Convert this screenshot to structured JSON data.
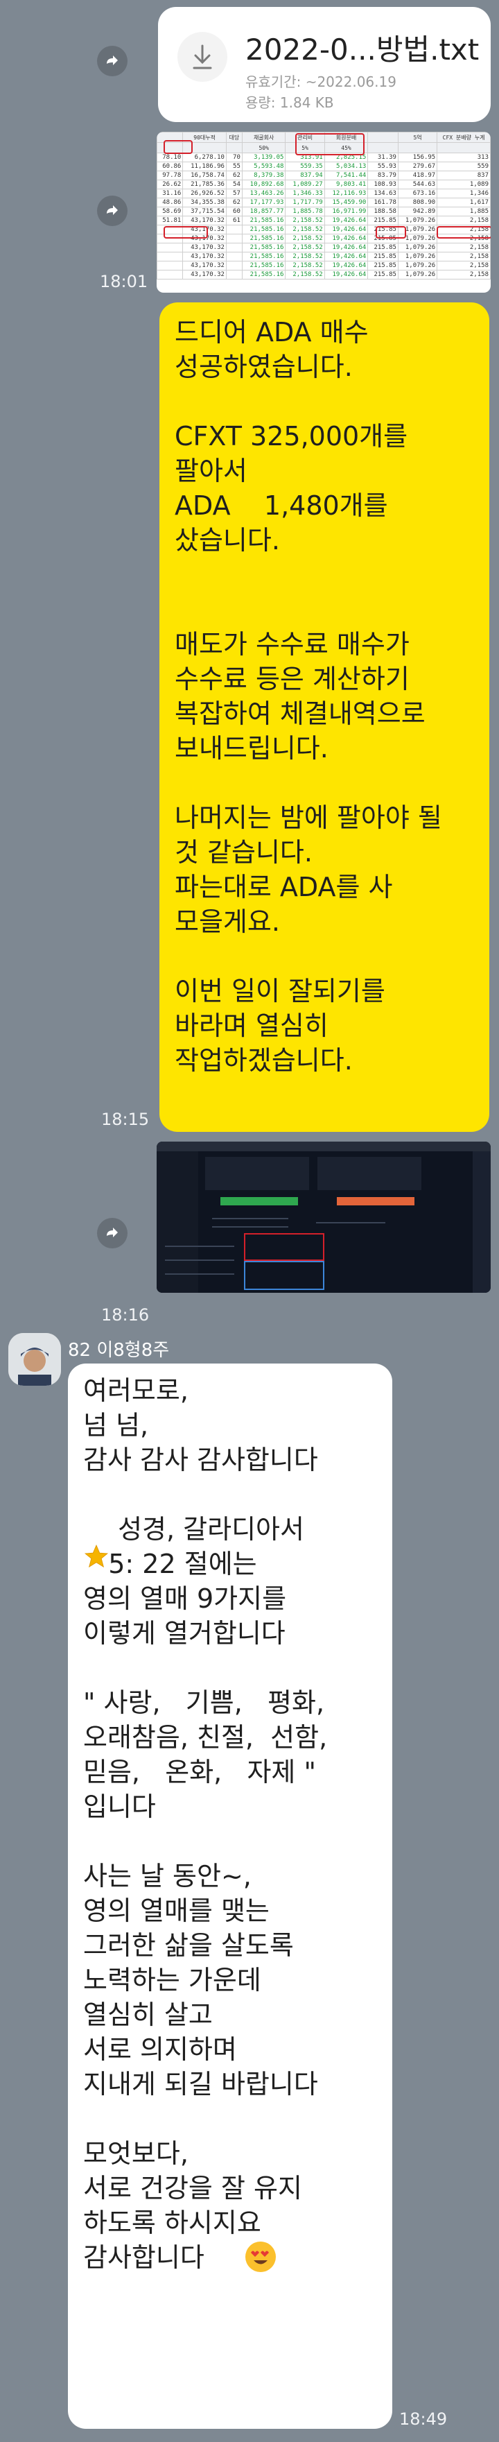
{
  "file_message": {
    "filename": "2022-0...방법.txt",
    "expiry": "유효기간: ~2022.06.19",
    "size": "용량: 1.84 KB"
  },
  "sheet_image": {
    "header_cells": [
      "매출 현황",
      "90대누적",
      "대당",
      "채굴회사",
      "관리비",
      "회원분배",
      "5억",
      "CFX 분배량 누계"
    ],
    "pct_cells": [
      "50%",
      "5%",
      "45%"
    ],
    "rows": [
      [
        "78.10",
        "6,278.10",
        "70",
        "3,139.05",
        "313.91",
        "2,825.15",
        "31.39",
        "156.95",
        "313"
      ],
      [
        "60.86",
        "11,186.96",
        "55",
        "5,593.48",
        "559.35",
        "5,034.13",
        "55.93",
        "279.67",
        "559"
      ],
      [
        "97.78",
        "16,758.74",
        "62",
        "8,379.38",
        "837.94",
        "7,541.44",
        "83.79",
        "418.97",
        "837"
      ],
      [
        "26.62",
        "21,785.36",
        "54",
        "10,892.68",
        "1,089.27",
        "9,803.41",
        "108.93",
        "544.63",
        "1,089"
      ],
      [
        "31.16",
        "26,926.52",
        "57",
        "13,463.26",
        "1,346.33",
        "12,116.93",
        "134.63",
        "673.16",
        "1,346"
      ],
      [
        "48.86",
        "34,355.38",
        "62",
        "17,177.93",
        "1,717.79",
        "15,459.90",
        "161.78",
        "808.90",
        "1,617"
      ],
      [
        "58.69",
        "37,715.54",
        "60",
        "18,857.77",
        "1,885.78",
        "16,971.99",
        "188.58",
        "942.89",
        "1,885"
      ],
      [
        "51.81",
        "43,170.32",
        "61",
        "21,585.16",
        "2,158.52",
        "19,426.64",
        "215.85",
        "1,079.26",
        "2,158"
      ],
      [
        "",
        "43,170.32",
        "",
        "21,585.16",
        "2,158.52",
        "19,426.64",
        "215.85",
        "1,079.26",
        "2,158"
      ],
      [
        "",
        "43,170.32",
        "",
        "21,585.16",
        "2,158.52",
        "19,426.64",
        "215.85",
        "1,079.26",
        "2,158"
      ],
      [
        "",
        "43,170.32",
        "",
        "21,585.16",
        "2,158.52",
        "19,426.64",
        "215.85",
        "1,079.26",
        "2,158"
      ],
      [
        "",
        "43,170.32",
        "",
        "21,585.16",
        "2,158.52",
        "19,426.64",
        "215.85",
        "1,079.26",
        "2,158"
      ],
      [
        "",
        "43,170.32",
        "",
        "21,585.16",
        "2,158.52",
        "19,426.64",
        "215.85",
        "1,079.26",
        "2,158"
      ],
      [
        "",
        "43,170.32",
        "",
        "21,585.16",
        "2,158.52",
        "19,426.64",
        "215.85",
        "1,079.26",
        "2,158"
      ]
    ]
  },
  "sent_text": "드디어 ADA 매수\n성공하였습니다.\n\nCFXT 325,000개를\n팔아서\nADA    1,480개를\n샀습니다.\n\n\n매도가 수수료 매수가\n수수료 등은 계산하기\n복잡하여 체결내역으로\n보내드립니다.\n\n나머지는 밤에 팔아야 될\n것 같습니다.\n파는대로 ADA를 사\n모을게요.\n\n이번 일이 잘되기를\n바라며 열심히\n작업하겠습니다.",
  "times": {
    "t1": "18:01",
    "t2": "18:15",
    "t3": "18:16",
    "t4": "18:49"
  },
  "sender": {
    "name": "82 이8형8주"
  },
  "received_lines": {
    "l1": "여러모로,",
    "l2": "넘 넘,",
    "l3": "감사 감사 감사합니다",
    "l4": " 성경, 갈라디아서",
    "l5": "   5: 22 절에는",
    "l6": "영의 열매 9가지를",
    "l7": "이렇게 열거합니다",
    "l8": "\" 사랑,   기쁨,   평화,",
    "l9": "오래참음, 친절,  선함,",
    "l10": "믿음,   온화,   자제 \"",
    "l11": "입니다",
    "l12": "사는 날 동안~,",
    "l13": "영의 열매를 맺는",
    "l14": "그러한 삶을 살도록",
    "l15": "노력하는 가운데",
    "l16": "열심히 살고",
    "l17": "서로 의지하며",
    "l18": "지내게 되길 바랍니다",
    "l19": "모엇보다,",
    "l20": "서로 건강을 잘 유지",
    "l21": "하도록 하시지요",
    "l22": "감사합니다"
  },
  "icons": {
    "share": "share-icon",
    "download": "download-icon",
    "star": "star-emoji-icon",
    "smile": "heart-eyes-emoji-icon"
  },
  "colors": {
    "background": "#7e8892",
    "sent_bubble": "#fee500",
    "received_bubble": "#ffffff",
    "highlight_box": "#d4202a"
  }
}
